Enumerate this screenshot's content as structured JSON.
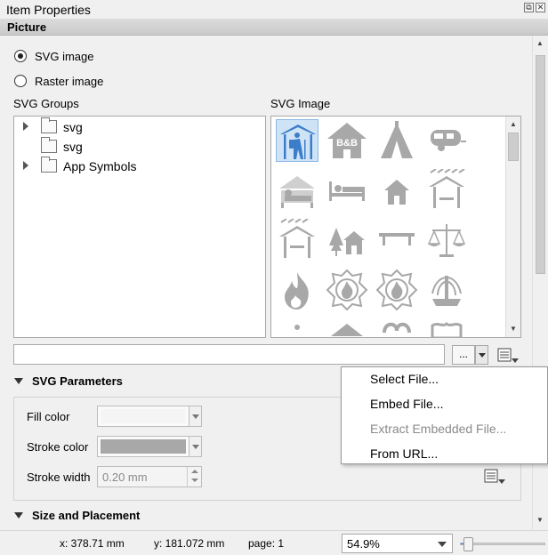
{
  "window": {
    "title": "Item Properties",
    "float_glyph": "⧉",
    "close_glyph": "✕"
  },
  "section_title": "Picture",
  "source_type": {
    "options": [
      {
        "label": "SVG image",
        "selected": true
      },
      {
        "label": "Raster image",
        "selected": false
      }
    ]
  },
  "svg_groups": {
    "label": "SVG Groups",
    "items": [
      {
        "label": "svg",
        "expandable": true
      },
      {
        "label": "svg",
        "expandable": false
      },
      {
        "label": "App Symbols",
        "expandable": true
      }
    ]
  },
  "svg_image": {
    "label": "SVG Image",
    "icons": [
      "hiker-shelter-icon",
      "bed-and-breakfast-icon",
      "tent-icon",
      "caravan-icon",
      "hostel-icon",
      "hotel-bed-icon",
      "house-icon",
      "shelter-rain-icon",
      "shelter-icon",
      "chalet-icon",
      "bench-icon",
      "justice-scales-icon",
      "fire-icon",
      "fire-station-icon",
      "fire-brigade-icon",
      "fountain-icon"
    ]
  },
  "path_field": {
    "value": "",
    "browse_label": "..."
  },
  "svg_parameters": {
    "title": "SVG Parameters",
    "fill_color_label": "Fill color",
    "fill_color": "#f5f5f5",
    "stroke_color_label": "Stroke color",
    "stroke_color": "#a8a8a8",
    "stroke_width_label": "Stroke width",
    "stroke_width_value": "0.20 mm"
  },
  "size_placement": {
    "title": "Size and Placement"
  },
  "context_menu": {
    "items": [
      {
        "label": "Select File...",
        "enabled": true
      },
      {
        "label": "Embed File...",
        "enabled": true
      },
      {
        "label": "Extract Embedded File...",
        "enabled": false
      },
      {
        "label": "From URL...",
        "enabled": true
      }
    ]
  },
  "statusbar": {
    "x_coord": "x: 378.71 mm",
    "y_coord": "y: 181.072 mm",
    "page": "page: 1",
    "zoom": "54.9%",
    "zoom_fraction": 0.08
  },
  "colors": {
    "icon_gray": "#a8a8a8",
    "icon_selected_blue": "#3b7dc9",
    "selection_bg": "#cfe3f7"
  }
}
